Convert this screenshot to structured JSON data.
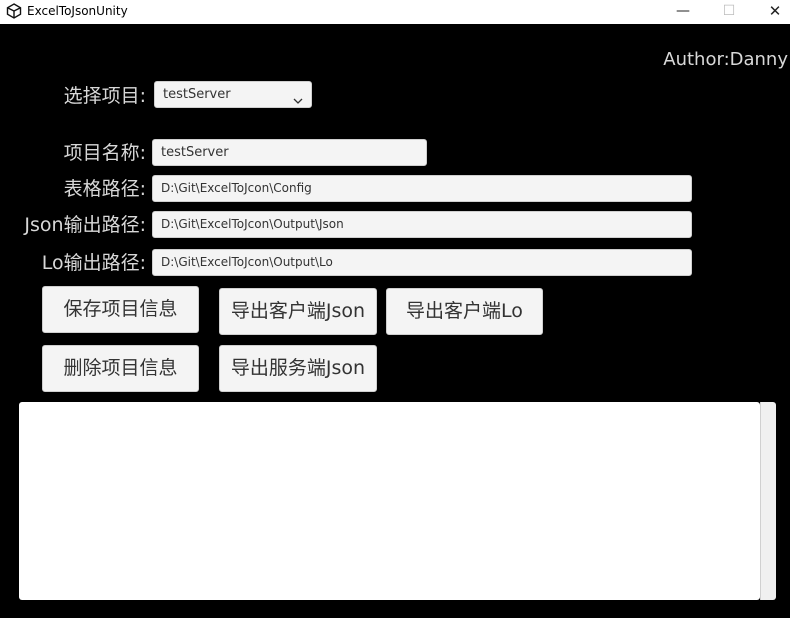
{
  "window": {
    "title": "ExcelToJsonUnity",
    "minimize_glyph": "—",
    "maximize_glyph": "☐",
    "close_glyph": "✕"
  },
  "author": "Author:Danny",
  "project_select": {
    "label": "选择项目:",
    "value": "testServer"
  },
  "form": {
    "name_label": "项目名称:",
    "name_value": "testServer",
    "table_path_label": "表格路径:",
    "table_path_value": "D:\\Git\\ExcelToJcon\\Config",
    "json_path_label": "Json输出路径:",
    "json_path_value": "D:\\Git\\ExcelToJcon\\Output\\Json",
    "lo_path_label": "Lo输出路径:",
    "lo_path_value": "D:\\Git\\ExcelToJcon\\Output\\Lo"
  },
  "buttons": {
    "save": "保存项目信息",
    "export_client_json": "导出客户端Json",
    "export_client_lo": "导出客户端Lo",
    "delete": "删除项目信息",
    "export_server_json": "导出服务端Json"
  },
  "log": {
    "text": ""
  },
  "icons": {
    "app": "unity-logo-icon",
    "dropdown": "chevron-down-icon"
  }
}
